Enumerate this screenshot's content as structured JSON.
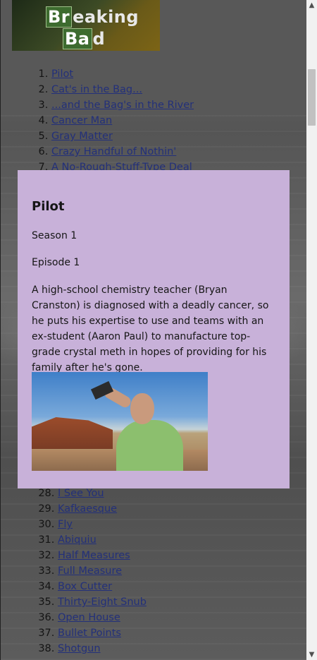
{
  "logo": {
    "line1_el": "Br",
    "line1_rest": "eaking",
    "line2_el": "Ba",
    "line2_rest": "d"
  },
  "episodes_top": [
    {
      "num": "1.",
      "title": "Pilot"
    },
    {
      "num": "2.",
      "title": "Cat's in the Bag..."
    },
    {
      "num": "3.",
      "title": "...and the Bag's in the River"
    },
    {
      "num": "4.",
      "title": "Cancer Man"
    },
    {
      "num": "5.",
      "title": "Gray Matter"
    },
    {
      "num": "6.",
      "title": "Crazy Handful of Nothin'"
    },
    {
      "num": "7.",
      "title": "A No-Rough-Stuff-Type Deal"
    }
  ],
  "episodes_bottom": [
    {
      "num": "28.",
      "title": "I See You"
    },
    {
      "num": "29.",
      "title": "Kafkaesque"
    },
    {
      "num": "30.",
      "title": "Fly"
    },
    {
      "num": "31.",
      "title": "Abiquiu"
    },
    {
      "num": "32.",
      "title": "Half Measures"
    },
    {
      "num": "33.",
      "title": "Full Measure"
    },
    {
      "num": "34.",
      "title": "Box Cutter"
    },
    {
      "num": "35.",
      "title": "Thirty-Eight Snub"
    },
    {
      "num": "36.",
      "title": "Open House"
    },
    {
      "num": "37.",
      "title": "Bullet Points"
    },
    {
      "num": "38.",
      "title": "Shotgun"
    }
  ],
  "popup": {
    "title": "Pilot",
    "season": "Season 1",
    "episode": "Episode 1",
    "summary": "A high-school chemistry teacher (Bryan Cranston) is diagnosed with a deadly cancer, so he puts his expertise to use and teams with an ex-student (Aaron Paul) to manufacture top-grade crystal meth in hopes of providing for his family after he's gone."
  },
  "scrollbar": {
    "up_icon": "▲",
    "down_icon": "▼"
  },
  "colors": {
    "popup_bg": "#c8b1d9",
    "link": "#23307a",
    "overlay": "#585858"
  }
}
